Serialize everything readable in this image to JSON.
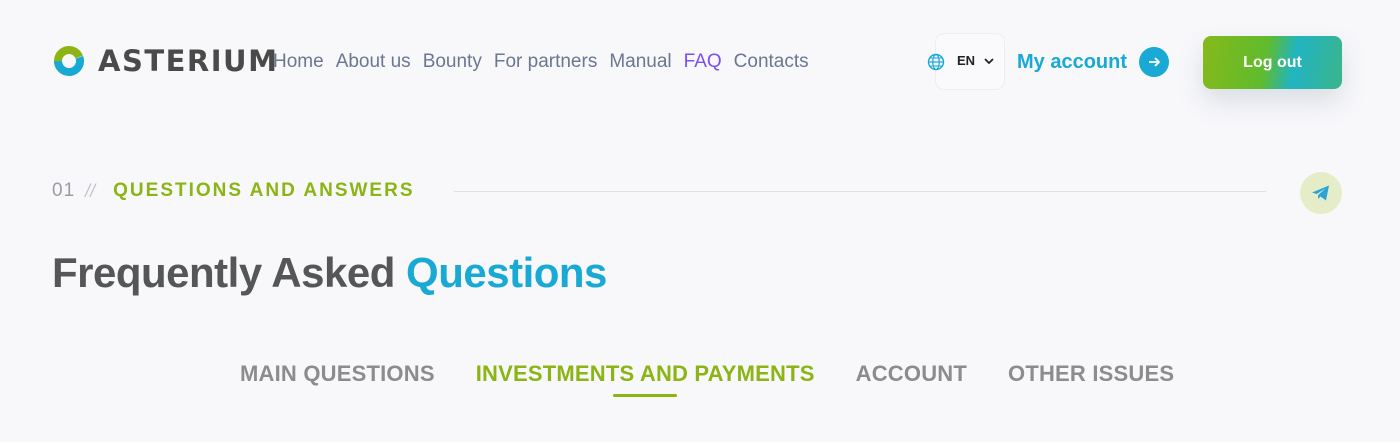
{
  "brand": {
    "name": "ASTERIUM"
  },
  "nav": {
    "items": [
      {
        "label": "Home",
        "active": false
      },
      {
        "label": "About us",
        "active": false
      },
      {
        "label": "Bounty",
        "active": false
      },
      {
        "label": "For partners",
        "active": false
      },
      {
        "label": "Manual",
        "active": false
      },
      {
        "label": "FAQ",
        "active": true
      },
      {
        "label": "Contacts",
        "active": false
      }
    ]
  },
  "language": {
    "code": "EN",
    "icon": "globe-icon"
  },
  "account": {
    "label": "My account",
    "icon": "arrow-right-icon"
  },
  "logout": {
    "label": "Log out"
  },
  "section": {
    "number": "01",
    "separator": "//",
    "title": "QUESTIONS AND ANSWERS",
    "social_icon": "telegram-icon"
  },
  "heading": {
    "part1": "Frequently Asked",
    "part2": "Questions"
  },
  "tabs": [
    {
      "label": "MAIN QUESTIONS",
      "active": false
    },
    {
      "label": "INVESTMENTS AND PAYMENTS",
      "active": true
    },
    {
      "label": "ACCOUNT",
      "active": false
    },
    {
      "label": "OTHER ISSUES",
      "active": false
    }
  ],
  "colors": {
    "accent_blue": "#18a9d4",
    "accent_green": "#8bb414",
    "nav_active": "#7b4ef1",
    "nav_text": "#6b7791",
    "heading_dark": "#555657"
  }
}
